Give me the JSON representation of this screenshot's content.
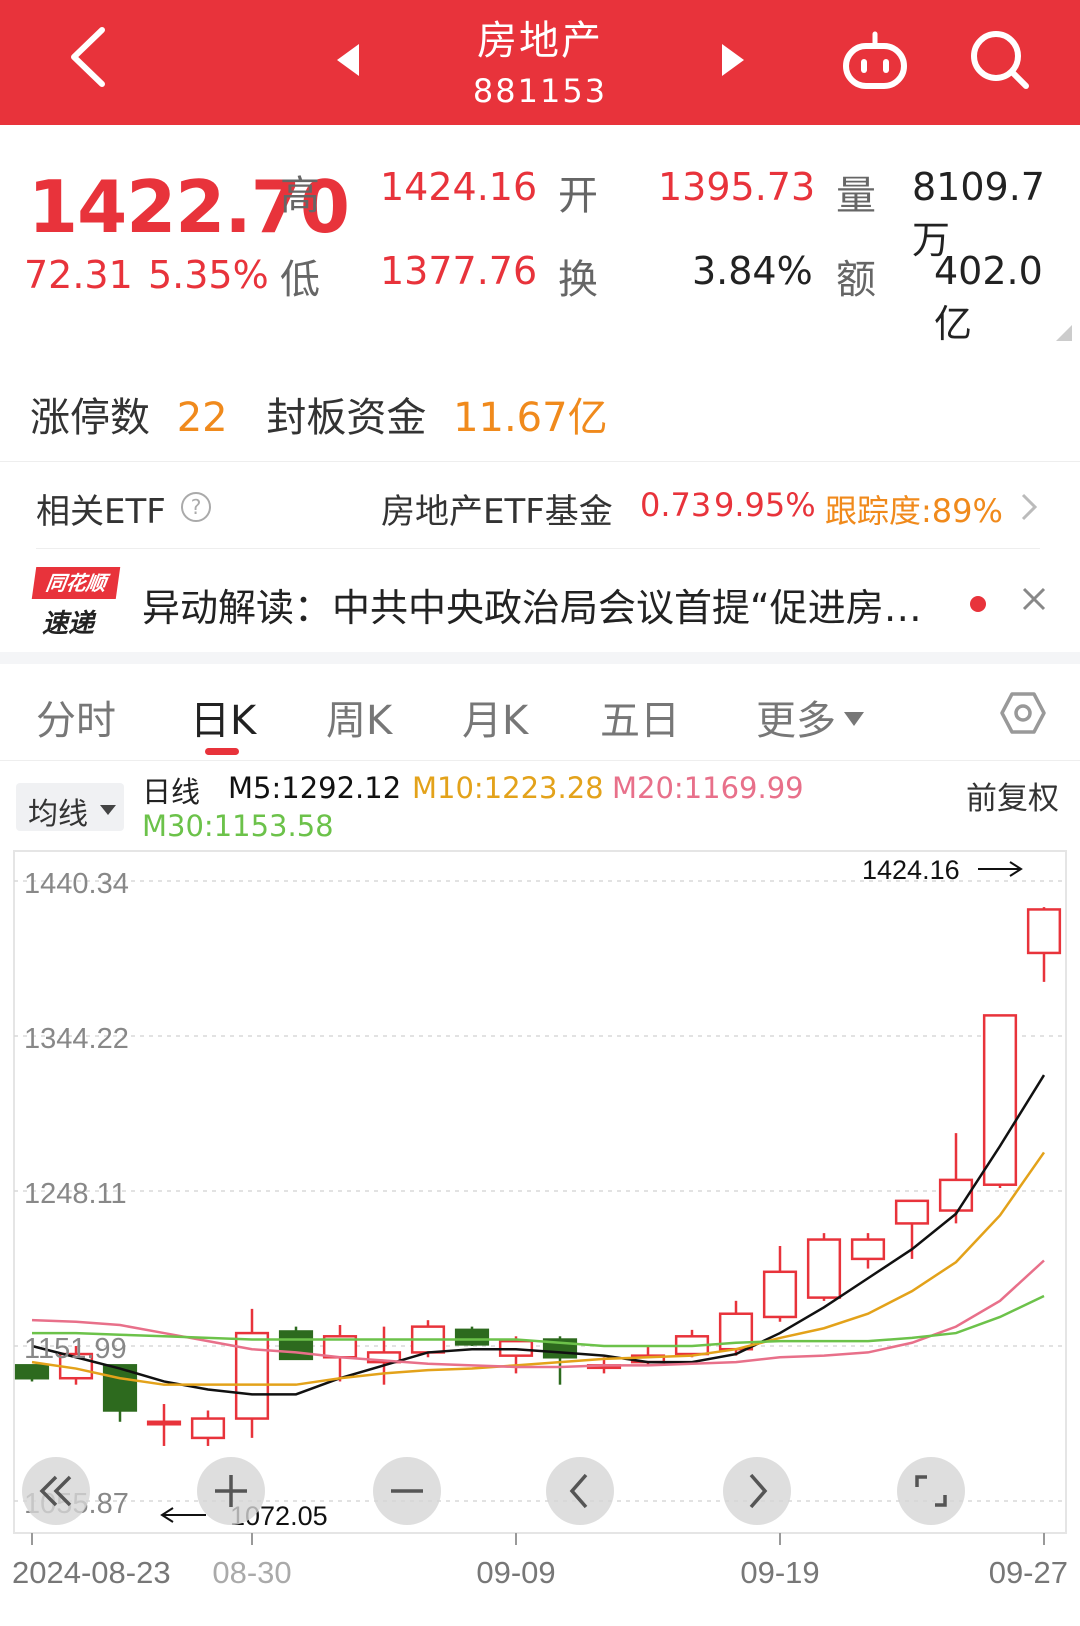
{
  "header": {
    "title": "房地产",
    "code": "881153"
  },
  "quote": {
    "price": "1422.70",
    "change": "72.31",
    "change_pct": "5.35%",
    "labels": {
      "high": "高",
      "open": "开",
      "volume": "量",
      "low": "低",
      "turnover": "换",
      "amount": "额"
    },
    "high": "1424.16",
    "open": "1395.73",
    "volume": "8109.7万",
    "low": "1377.76",
    "turnover_rate": "3.84%",
    "amount": "402.0亿"
  },
  "limit_up": {
    "label": "涨停数",
    "count": "22",
    "fund_label": "封板资金",
    "fund": "11.67亿"
  },
  "etf": {
    "title": "相关ETF",
    "help_glyph": "?",
    "name": "房地产ETF基金",
    "price": "0.73",
    "pct": "9.95%",
    "tracking": "跟踪度:89%"
  },
  "news": {
    "logo_top": "同花顺",
    "logo_bottom": "速递",
    "text": "异动解读：中共中央政治局会议首提“促进房…"
  },
  "tabs": [
    {
      "label": "分时"
    },
    {
      "label": "日K"
    },
    {
      "label": "周K"
    },
    {
      "label": "月K"
    },
    {
      "label": "五日"
    },
    {
      "label": "更多"
    }
  ],
  "ma_bar": {
    "selector": "均线",
    "period": "日线",
    "m5": "M5:1292.12",
    "m10": "M10:1223.28",
    "m20": "M20:1169.99",
    "m30": "M30:1153.58",
    "adjust": "前复权"
  },
  "colors": {
    "brand_red": "#e8333b",
    "up": "#e8333b",
    "down": "#2d6a1e",
    "m5": "#111111",
    "m10": "#e3a21a",
    "m20": "#e8708a",
    "m30": "#6cc24a",
    "orange": "#f08a1c"
  },
  "chart_data": {
    "type": "candlestick",
    "y_ticks": [
      "1440.34",
      "1344.22",
      "1248.11",
      "1151.99",
      "1055.87"
    ],
    "ylim": [
      1055.87,
      1440.34
    ],
    "x_labels": [
      "2024-08-23",
      "08-30",
      "09-09",
      "09-19",
      "09-27"
    ],
    "x_label_index": [
      0,
      5,
      11,
      17,
      23
    ],
    "max_label": "1424.16",
    "min_label": "1072.05",
    "candles": [
      {
        "o": 1140,
        "c": 1132,
        "h": 1140,
        "l": 1130
      },
      {
        "o": 1132,
        "c": 1147,
        "h": 1152,
        "l": 1128
      },
      {
        "o": 1140,
        "c": 1112,
        "h": 1140,
        "l": 1105
      },
      {
        "o": 1105,
        "c": 1105,
        "h": 1116,
        "l": 1090
      },
      {
        "o": 1095,
        "c": 1107,
        "h": 1112,
        "l": 1090
      },
      {
        "o": 1107,
        "c": 1160,
        "h": 1175,
        "l": 1095
      },
      {
        "o": 1161,
        "c": 1144,
        "h": 1164,
        "l": 1144
      },
      {
        "o": 1145,
        "c": 1158,
        "h": 1165,
        "l": 1130
      },
      {
        "o": 1142,
        "c": 1148,
        "h": 1164,
        "l": 1128
      },
      {
        "o": 1148,
        "c": 1164,
        "h": 1168,
        "l": 1145
      },
      {
        "o": 1162,
        "c": 1153,
        "h": 1164,
        "l": 1152
      },
      {
        "o": 1146,
        "c": 1155,
        "h": 1158,
        "l": 1135
      },
      {
        "o": 1156,
        "c": 1145,
        "h": 1158,
        "l": 1128
      },
      {
        "o": 1139,
        "c": 1140,
        "h": 1145,
        "l": 1135
      },
      {
        "o": 1142,
        "c": 1146,
        "h": 1152,
        "l": 1140
      },
      {
        "o": 1147,
        "c": 1158,
        "h": 1162,
        "l": 1145
      },
      {
        "o": 1150,
        "c": 1172,
        "h": 1180,
        "l": 1146
      },
      {
        "o": 1170,
        "c": 1198,
        "h": 1214,
        "l": 1167
      },
      {
        "o": 1182,
        "c": 1218,
        "h": 1222,
        "l": 1180
      },
      {
        "o": 1206,
        "c": 1218,
        "h": 1222,
        "l": 1200
      },
      {
        "o": 1228,
        "c": 1242,
        "h": 1242,
        "l": 1206
      },
      {
        "o": 1236,
        "c": 1255,
        "h": 1284,
        "l": 1228
      },
      {
        "o": 1252,
        "c": 1357,
        "h": 1357,
        "l": 1250
      },
      {
        "o": 1395.73,
        "c": 1422.7,
        "h": 1424.16,
        "l": 1377.76
      }
    ],
    "ma": {
      "M5": [
        1152,
        1145,
        1138,
        1130,
        1125,
        1122,
        1122,
        1132,
        1140,
        1148,
        1150,
        1150,
        1148,
        1146,
        1142,
        1142,
        1147,
        1160,
        1176,
        1194,
        1212,
        1234,
        1276,
        1320
      ],
      "M10": [
        1142,
        1138,
        1132,
        1128,
        1128,
        1128,
        1128,
        1132,
        1135,
        1137,
        1138,
        1140,
        1142,
        1144,
        1145,
        1146,
        1150,
        1157,
        1163,
        1172,
        1186,
        1204,
        1233,
        1272
      ],
      "M20": [
        1168,
        1167,
        1165,
        1160,
        1155,
        1150,
        1148,
        1145,
        1143,
        1141,
        1140,
        1139,
        1139,
        1140,
        1140,
        1141,
        1142,
        1145,
        1146,
        1148,
        1154,
        1164,
        1180,
        1205
      ],
      "M30": [
        1160,
        1160,
        1159,
        1158,
        1157,
        1156,
        1156,
        1156,
        1156,
        1156,
        1156,
        1156,
        1154,
        1152,
        1152,
        1152,
        1154,
        1155,
        1155,
        1155,
        1157,
        1160,
        1170,
        1183
      ]
    }
  }
}
